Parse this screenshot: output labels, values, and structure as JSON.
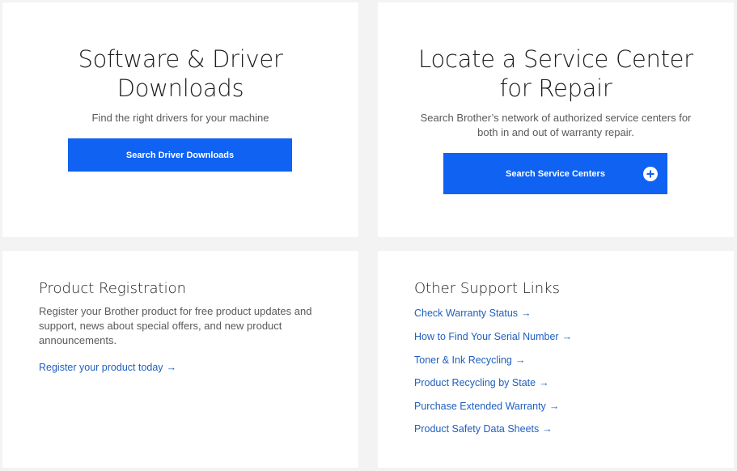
{
  "software": {
    "title_line1": "Software & Driver",
    "title_line2": "Downloads",
    "description": "Find the right drivers for your machine",
    "button_label": "Search Driver Downloads"
  },
  "service": {
    "title_line1": "Locate a Service Center",
    "title_line2": "for Repair",
    "description_line1": "Search Brother’s network of authorized service centers for",
    "description_line2": "both in and out of warranty repair.",
    "button_label": "Search Service Centers",
    "button_icon": "plus-circle-icon"
  },
  "registration": {
    "title": "Product Registration",
    "description_line1": "Register your Brother product for free product updates and",
    "description_line2": "support, news about special offers, and new product",
    "description_line3": "announcements.",
    "link_label": "Register your product today",
    "arrow": "→"
  },
  "support_links": {
    "title": "Other Support Links",
    "arrow": "→",
    "items": [
      {
        "label": "Check Warranty Status"
      },
      {
        "label": "How to Find Your Serial Number"
      },
      {
        "label": "Toner & Ink Recycling"
      },
      {
        "label": "Product Recycling by State"
      },
      {
        "label": "Purchase Extended Warranty"
      },
      {
        "label": "Product Safety Data Sheets"
      }
    ]
  },
  "colors": {
    "button": "#0f62f2",
    "link": "#1f5fbf",
    "page_bg": "#f3f3f4"
  }
}
